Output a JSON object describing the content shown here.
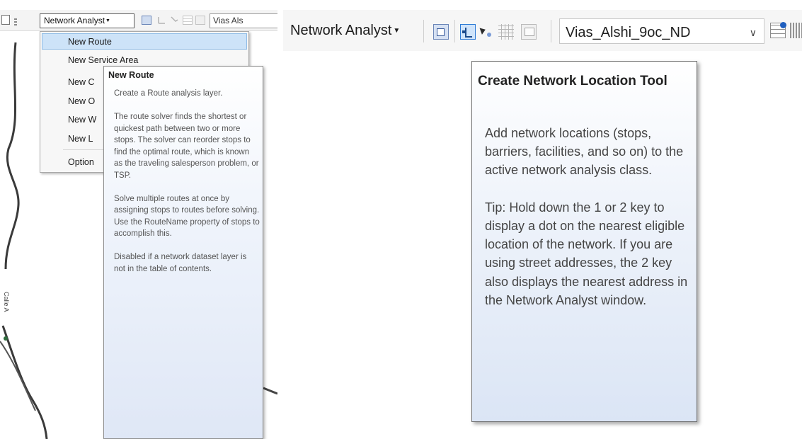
{
  "left_panel": {
    "toolbar": {
      "network_analyst_label": "Network Analyst",
      "network_dataset_partial": "Vias Als"
    },
    "menu": {
      "items": [
        {
          "label": "New Route",
          "highlighted": true
        },
        {
          "label": "New Service Area"
        },
        {
          "label": "New C"
        },
        {
          "label": "New O"
        },
        {
          "label": "New W"
        },
        {
          "label": "New L"
        },
        {
          "label": "Option"
        }
      ]
    },
    "tooltip": {
      "title": "New Route",
      "body": "Create a Route analysis layer.\n\nThe route solver finds the shortest or quickest path between two or more stops. The solver can reorder stops to find the optimal route, which is known as the traveling salesperson problem, or TSP.\n\nSolve multiple routes at once by assigning stops to routes before solving. Use the RouteName property of stops to accomplish this.\n\nDisabled if a network dataset layer is not in the table of contents."
    },
    "map_labels": [
      "Calle A"
    ]
  },
  "right_panel": {
    "toolbar": {
      "network_analyst_label": "Network Analyst",
      "network_dataset_value": "Vias_Alshi_9oc_ND"
    },
    "tooltip": {
      "title": "Create Network Location Tool",
      "body": "Add network locations (stops, barriers, facilities, and so on) to the active network analysis class.\n\nTip: Hold down the 1 or 2 key to display a dot on the nearest eligible location of the network. If you are using street addresses, the 2 key also displays the nearest address in the Network Analyst window."
    }
  }
}
